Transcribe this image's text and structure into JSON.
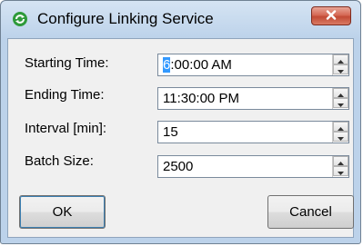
{
  "window": {
    "title": "Configure Linking Service",
    "icons": {
      "app": "recycle-icon",
      "close": "close-icon"
    }
  },
  "fields": [
    {
      "label": "Starting Time:",
      "value_caret": "6",
      "value_rest": ":00:00 AM"
    },
    {
      "label": "Ending Time:",
      "value": "11:30:00 PM"
    },
    {
      "label": "Interval [min]:",
      "value": "15"
    },
    {
      "label": "Batch Size:",
      "value": "2500"
    }
  ],
  "buttons": {
    "ok_label": "OK",
    "cancel_label": "Cancel"
  },
  "colors": {
    "titlebar": "#bcd2ea",
    "close_button": "#c24a35",
    "dialog_body": "#f0f0f0",
    "selection": "#3399ff"
  }
}
